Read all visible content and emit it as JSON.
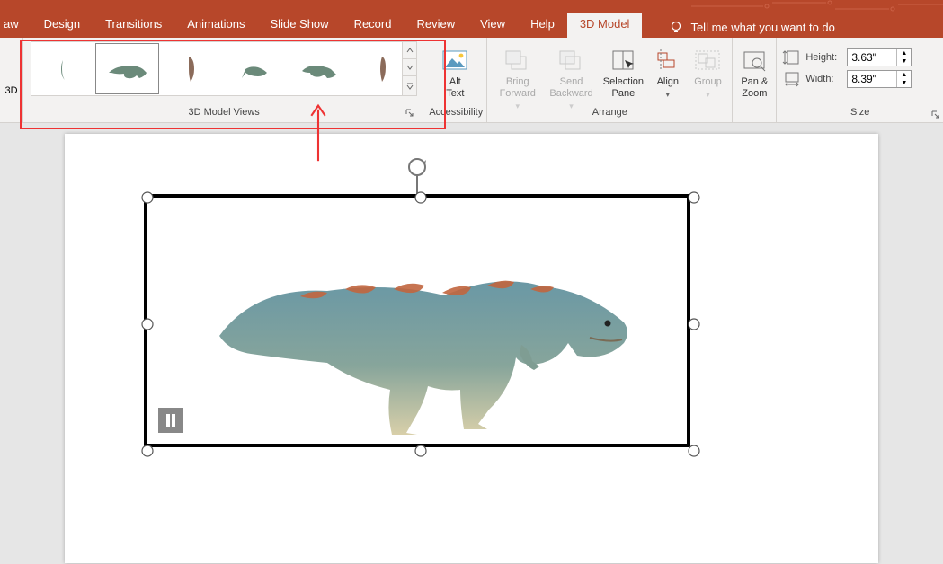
{
  "tabs": {
    "items": [
      {
        "label": "aw",
        "partial": true
      },
      {
        "label": "Design"
      },
      {
        "label": "Transitions"
      },
      {
        "label": "Animations"
      },
      {
        "label": "Slide Show"
      },
      {
        "label": "Record"
      },
      {
        "label": "Review"
      },
      {
        "label": "View"
      },
      {
        "label": "Help"
      },
      {
        "label": "3D Model",
        "active": true
      }
    ],
    "tell_me": "Tell me what you want to do"
  },
  "ribbon": {
    "insert3d_label": "3D",
    "model_views": {
      "group_label": "3D Model Views"
    },
    "accessibility": {
      "alt_text": "Alt\nText",
      "group_label": "Accessibility"
    },
    "arrange": {
      "bring_forward": "Bring\nForward",
      "send_backward": "Send\nBackward",
      "selection_pane": "Selection\nPane",
      "align": "Align",
      "group": "Group",
      "group_label": "Arrange"
    },
    "panzoom": "Pan &\nZoom",
    "size": {
      "height_label": "Height:",
      "height_value": "3.63\"",
      "width_label": "Width:",
      "width_value": "8.39\"",
      "group_label": "Size"
    }
  }
}
